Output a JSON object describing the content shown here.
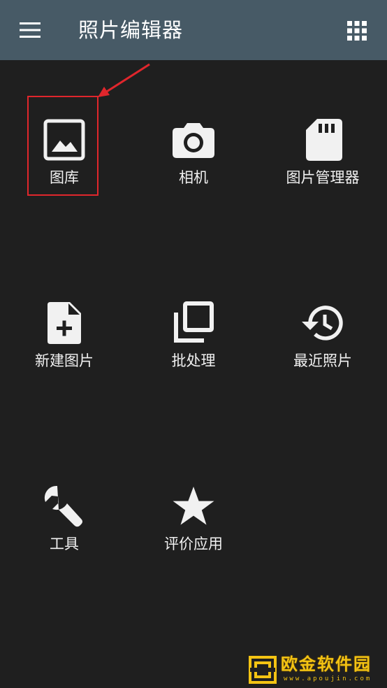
{
  "app": {
    "title": "照片编辑器"
  },
  "toolbar": {
    "menu_icon": "hamburger-menu-icon",
    "grid_icon": "apps-grid-icon"
  },
  "tiles": [
    {
      "label": "图库",
      "icon": "image-icon"
    },
    {
      "label": "相机",
      "icon": "camera-icon"
    },
    {
      "label": "图片管理器",
      "icon": "sd-card-icon"
    },
    {
      "label": "新建图片",
      "icon": "add-file-icon"
    },
    {
      "label": "批处理",
      "icon": "library-icon"
    },
    {
      "label": "最近照片",
      "icon": "history-icon"
    },
    {
      "label": "工具",
      "icon": "wrench-icon"
    },
    {
      "label": "评价应用",
      "icon": "star-icon"
    }
  ],
  "annotation": {
    "color": "#e0262c",
    "target": "图库"
  },
  "watermark": {
    "name": "欧金软件园",
    "url": "www.apoujin.com"
  },
  "colors": {
    "topbar": "#475a66",
    "background": "#1f1f1f",
    "icon": "#f1f1f1",
    "watermark": "#f3c313"
  }
}
